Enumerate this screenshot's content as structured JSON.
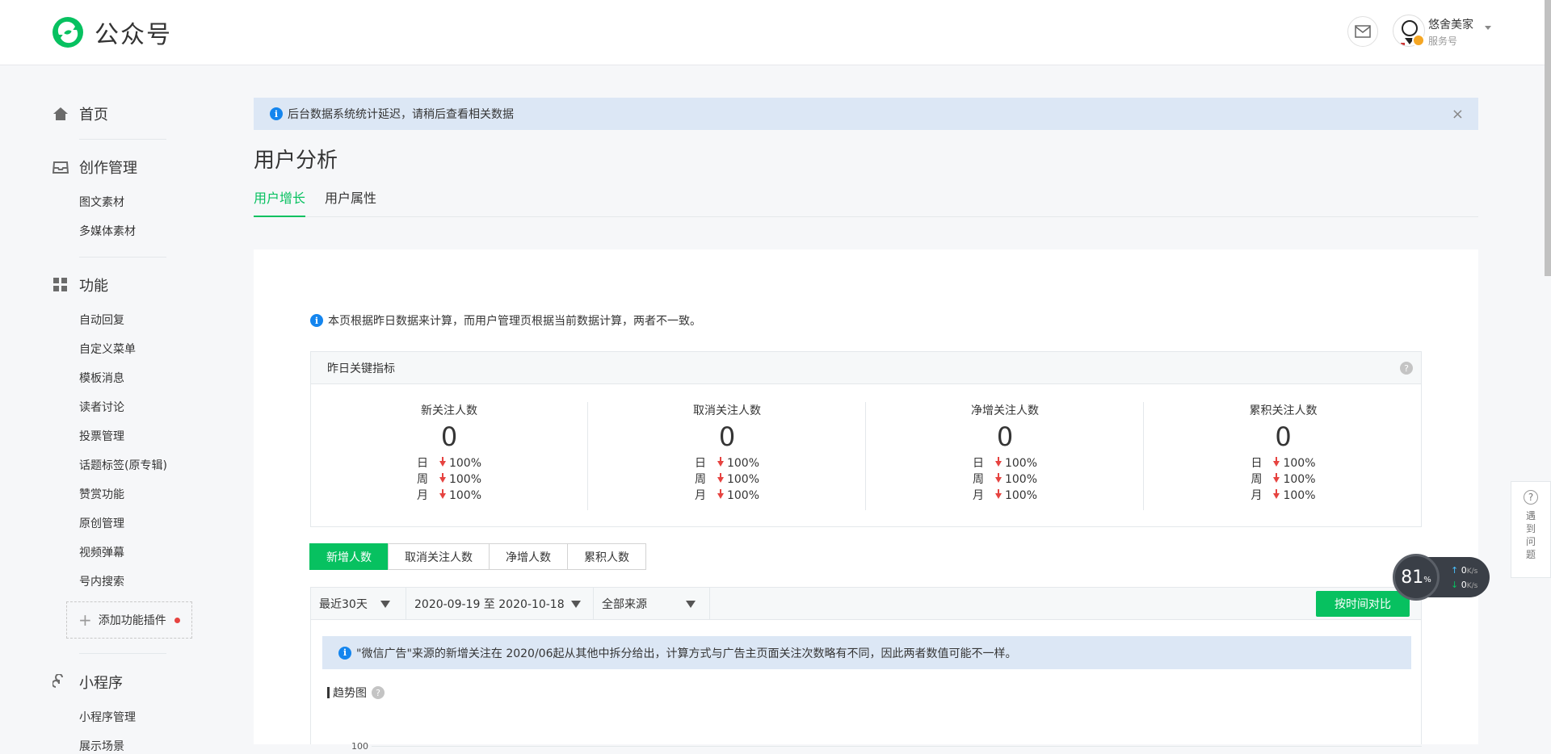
{
  "header": {
    "logo_text": "公众号",
    "account_name": "悠舍美家",
    "account_type": "服务号"
  },
  "sidebar": {
    "home": "首页",
    "creation": {
      "label": "创作管理",
      "items": [
        "图文素材",
        "多媒体素材"
      ]
    },
    "features": {
      "label": "功能",
      "items": [
        "自动回复",
        "自定义菜单",
        "模板消息",
        "读者讨论",
        "投票管理",
        "话题标签(原专辑)",
        "赞赏功能",
        "原创管理",
        "视频弹幕",
        "号内搜索"
      ]
    },
    "add_plugin": "添加功能插件",
    "miniprogram": {
      "label": "小程序",
      "items": [
        "小程序管理",
        "展示场景"
      ]
    }
  },
  "notice": {
    "text": "后台数据系统统计延迟，请稍后查看相关数据",
    "close": "×"
  },
  "page": {
    "title": "用户分析",
    "tabs": [
      "用户增长",
      "用户属性"
    ]
  },
  "card": {
    "tip": "本页根据昨日数据来计算，而用户管理页根据当前数据计算，两者不一致。",
    "kpi_title": "昨日关键指标",
    "kpis": [
      {
        "name": "新关注人数",
        "value": "0",
        "day": "100%",
        "week": "100%",
        "month": "100%"
      },
      {
        "name": "取消关注人数",
        "value": "0",
        "day": "100%",
        "week": "100%",
        "month": "100%"
      },
      {
        "name": "净增关注人数",
        "value": "0",
        "day": "100%",
        "week": "100%",
        "month": "100%"
      },
      {
        "name": "累积关注人数",
        "value": "0",
        "day": "100%",
        "week": "100%",
        "month": "100%"
      }
    ],
    "period_labels": {
      "day": "日",
      "week": "周",
      "month": "月"
    },
    "segments": [
      "新增人数",
      "取消关注人数",
      "净增人数",
      "累积人数"
    ],
    "filters": {
      "range": "最近30天",
      "dates": "2020-09-19 至 2020-10-18",
      "source": "全部来源",
      "compare": "按时间对比"
    },
    "ad_tip": "\"微信广告\"来源的新增关注在 2020/06起从其他中拆分给出，计算方式与广告主页面关注次数略有不同，因此两者数值可能不一样。",
    "trend_title": "趋势图",
    "y_tick": "100"
  },
  "help_side": {
    "q": "?",
    "text": "遇到问题"
  },
  "speed": {
    "percent": "81",
    "unit": "%",
    "up": "0",
    "down": "0",
    "rate_unit": "K/s"
  },
  "colors": {
    "brand_green": "#07c160",
    "info_blue": "#1485ee",
    "down_red": "#e64340"
  }
}
